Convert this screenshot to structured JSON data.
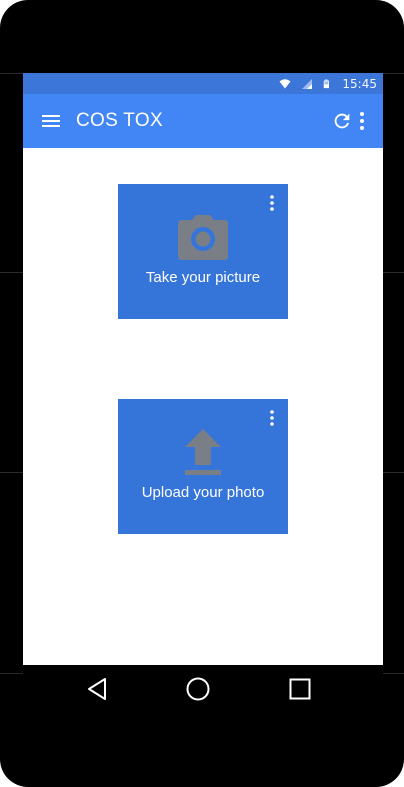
{
  "status_bar": {
    "time": "15:45",
    "icons": [
      "wifi-icon",
      "signal-icon",
      "battery-icon"
    ]
  },
  "app_bar": {
    "title": "COS TOX",
    "menu_icon": "hamburger-menu-icon",
    "refresh_icon": "refresh-icon",
    "overflow_icon": "more-vert-icon"
  },
  "cards": [
    {
      "id": "take-picture",
      "label": "Take your picture",
      "icon": "camera-icon"
    },
    {
      "id": "upload-photo",
      "label": "Upload your photo",
      "icon": "upload-icon"
    }
  ],
  "nav_bar": {
    "buttons": [
      "back-icon",
      "home-icon",
      "recents-icon"
    ]
  },
  "colors": {
    "status_bar": "#3b76d8",
    "app_bar": "#4285f4",
    "card": "#3574d8",
    "card_icon": "#7a7f87",
    "frame": "#000000"
  }
}
